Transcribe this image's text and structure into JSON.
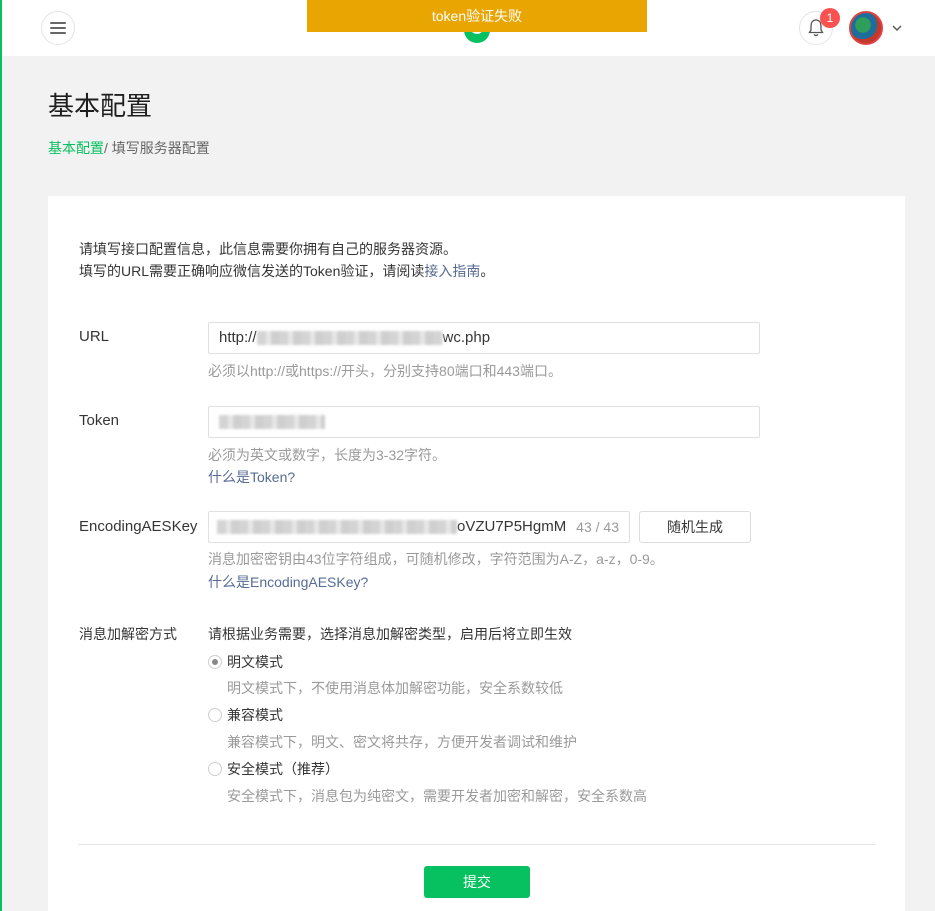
{
  "toast": {
    "text": "token验证失败",
    "color": "#e9a502"
  },
  "header": {
    "menu_icon": "hamburger-icon",
    "logo_icon": "wechat-logo-icon",
    "bell_icon": "bell-icon",
    "notification_count": "1",
    "avatar_icon": "user-avatar",
    "caret_icon": "chevron-down-icon"
  },
  "page": {
    "title": "基本配置",
    "breadcrumb_link": "基本配置",
    "breadcrumb_current": "/ 填写服务器配置"
  },
  "intro": {
    "line1": "请填写接口配置信息，此信息需要你拥有自己的服务器资源。",
    "line2_prefix": "填写的URL需要正确响应微信发送的Token验证，请阅读",
    "line2_link": "接入指南",
    "line2_suffix": "。"
  },
  "url": {
    "label": "URL",
    "value_prefix": "http://",
    "value_suffix": "wc.php",
    "hint": "必须以http://或https://开头，分别支持80端口和443端口。"
  },
  "token": {
    "label": "Token",
    "hint": "必须为英文或数字，长度为3-32字符。",
    "help_link": "什么是Token?"
  },
  "aes": {
    "label": "EncodingAESKey",
    "value_suffix": "oVZU7P5HgmM",
    "count": "43 / 43",
    "random_button": "随机生成",
    "hint": "消息加密密钥由43位字符组成，可随机修改，字符范围为A-Z，a-z，0-9。",
    "help_link": "什么是EncodingAESKey?"
  },
  "encryption": {
    "label": "消息加解密方式",
    "description": "请根据业务需要，选择消息加解密类型，启用后将立即生效",
    "options": [
      {
        "label": "明文模式",
        "desc": "明文模式下，不使用消息体加解密功能，安全系数较低",
        "checked": true
      },
      {
        "label": "兼容模式",
        "desc": "兼容模式下，明文、密文将共存，方便开发者调试和维护",
        "checked": false
      },
      {
        "label": "安全模式（推荐）",
        "desc": "安全模式下，消息包为纯密文，需要开发者加密和解密，安全系数高",
        "checked": false
      }
    ]
  },
  "submit_button": "提交",
  "colors": {
    "accent": "#07c160",
    "link": "#576b95",
    "badge": "#fa5151"
  }
}
